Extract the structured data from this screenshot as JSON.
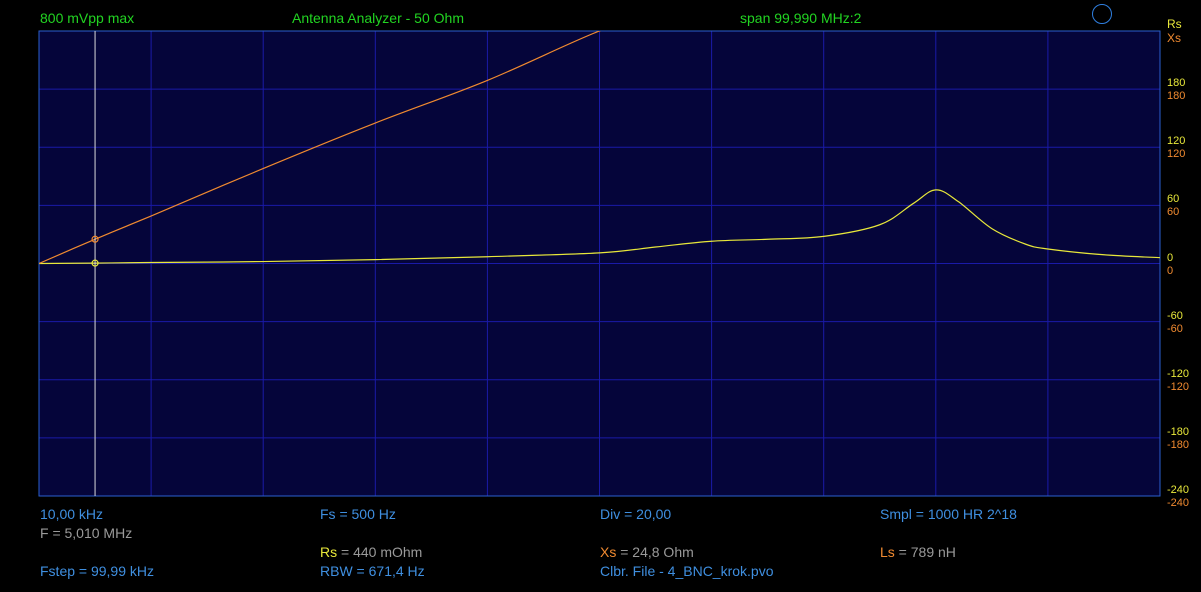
{
  "header": {
    "left": "800 mVpp max",
    "center": "Antenna Analyzer - 50 Ohm",
    "right": "span 99,990 MHz:2"
  },
  "legend": {
    "rs": "Rs",
    "xs": "Xs"
  },
  "colors": {
    "background": "#000000",
    "plot_bg": "#05053a",
    "grid": "#1a1aa8",
    "rs_trace": "#e8e83a",
    "xs_trace": "#f08a30",
    "cursor": "#dcdcdc"
  },
  "footer": {
    "start_freq": "10,00 kHz",
    "f_label": "F = 5,010 MHz",
    "fs": "Fs = 500 Hz",
    "div": "Div = 20,00",
    "smpl": "Smpl = 1000 HR  2^18",
    "rs_name": "Rs",
    "rs_value": " = 440 mOhm",
    "xs_name": "Xs",
    "xs_value": " = 24,8 Ohm",
    "ls_name": "Ls",
    "ls_value": " = 789 nH",
    "fstep": "Fstep = 99,99 kHz",
    "rbw": "RBW = 671,4 Hz",
    "calibration": "Clbr. File - 4_BNC_krok.pvo"
  },
  "chart_data": {
    "type": "line",
    "x_range": [
      0.01,
      100.0
    ],
    "ylim": [
      -240,
      240
    ],
    "y_ticks": [
      180,
      120,
      60,
      0,
      -60,
      -120,
      -180,
      -240
    ],
    "y_tick_labels": [
      "180",
      "120",
      "60",
      "0",
      "-60",
      "-120",
      "-180",
      "-240"
    ],
    "grid": true,
    "x_divisions": 10,
    "cursor_x": 5.01,
    "series": [
      {
        "name": "Rs",
        "color": "#e8e83a",
        "x": [
          0.01,
          5,
          10,
          20,
          30,
          40,
          50,
          55,
          60,
          65,
          70,
          75,
          78,
          80,
          82,
          85,
          88,
          90,
          95,
          100
        ],
        "y": [
          0,
          0.4,
          1,
          2,
          4,
          7,
          11,
          17,
          23,
          25,
          28,
          40,
          62,
          76,
          64,
          36,
          20,
          15,
          9,
          6
        ]
      },
      {
        "name": "Xs",
        "color": "#f08a30",
        "x": [
          0.01,
          5,
          10,
          20,
          30,
          40,
          50,
          55,
          60,
          65,
          70,
          73,
          75,
          77,
          80,
          82,
          84,
          90,
          95,
          100
        ],
        "y": [
          0,
          25,
          49,
          98,
          145,
          189,
          240,
          256,
          264,
          276,
          300,
          313,
          315,
          300,
          264,
          260,
          270,
          313,
          350,
          380
        ]
      }
    ]
  }
}
